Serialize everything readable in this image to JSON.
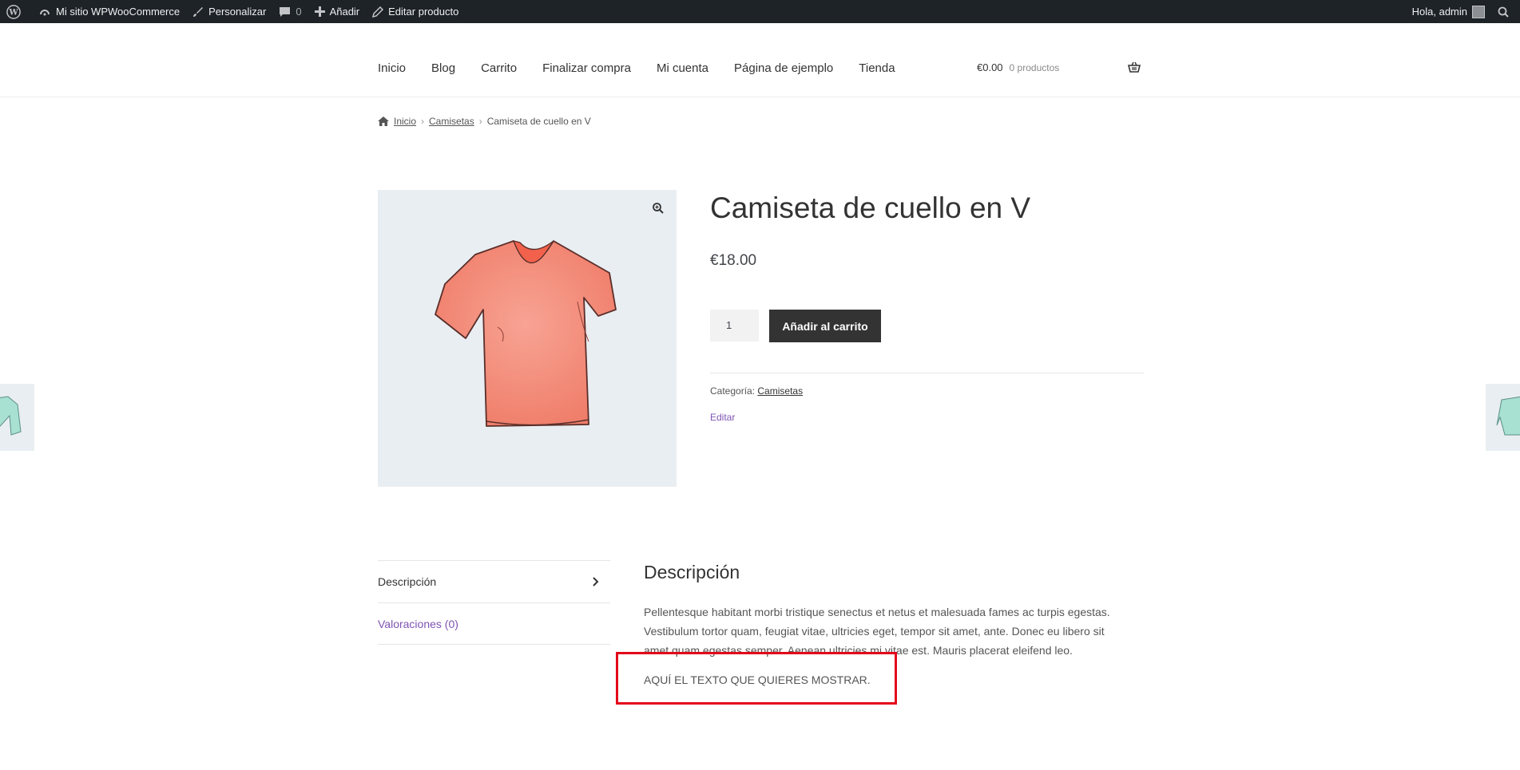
{
  "admin_bar": {
    "site_name": "Mi sitio WPWooCommerce",
    "customize": "Personalizar",
    "comments_count": "0",
    "add_new": "Añadir",
    "edit_product": "Editar producto",
    "greeting": "Hola, admin"
  },
  "nav": {
    "items": [
      "Inicio",
      "Blog",
      "Carrito",
      "Finalizar compra",
      "Mi cuenta",
      "Página de ejemplo",
      "Tienda"
    ]
  },
  "cart": {
    "amount": "€0.00",
    "count": "0 productos"
  },
  "breadcrumb": {
    "home": "Inicio",
    "category": "Camisetas",
    "current": "Camiseta de cuello en V"
  },
  "product": {
    "title": "Camiseta de cuello en V",
    "price": "€18.00",
    "quantity": "1",
    "add_to_cart": "Añadir al carrito",
    "category_label": "Categoría:",
    "category": "Camisetas",
    "edit": "Editar",
    "image_color": "#f28a78"
  },
  "tabs": {
    "description": "Descripción",
    "reviews": "Valoraciones (0)"
  },
  "description": {
    "title": "Descripción",
    "text": "Pellentesque habitant morbi tristique senectus et netus et malesuada fames ac turpis egestas. Vestibulum tortor quam, feugiat vitae, ultricies eget, tempor sit amet, ante. Donec eu libero sit amet quam egestas semper. Aenean ultricies mi vitae est. Mauris placerat eleifend leo.",
    "custom_text": "AQUÍ EL TEXTO QUE QUIERES MOSTRAR.",
    "highlight_color": "#e3061a"
  },
  "colors": {
    "admin_bar_bg": "#1d2327",
    "button_bg": "#333333",
    "link_purple": "#7f54b3"
  }
}
